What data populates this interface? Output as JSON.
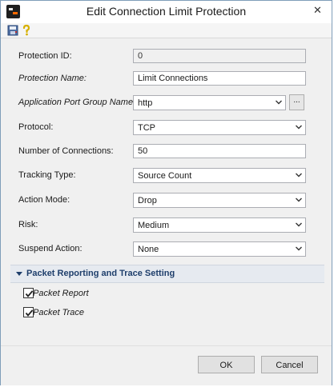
{
  "window": {
    "title": "Edit Connection Limit Protection",
    "close_glyph": "✕"
  },
  "toolbar": {
    "icons": [
      "save-icon",
      "help-icon"
    ]
  },
  "form": {
    "protection_id": {
      "label": "Protection ID:",
      "value": "0"
    },
    "protection_name": {
      "label": "Protection Name:",
      "value": "Limit Connections"
    },
    "app_port_group": {
      "label": "Application Port Group Name:",
      "value": "http",
      "browse_label": "..."
    },
    "protocol": {
      "label": "Protocol:",
      "value": "TCP"
    },
    "num_connections": {
      "label": "Number of Connections:",
      "value": "50"
    },
    "tracking_type": {
      "label": "Tracking Type:",
      "value": "Source Count"
    },
    "action_mode": {
      "label": "Action Mode:",
      "value": "Drop"
    },
    "risk": {
      "label": "Risk:",
      "value": "Medium"
    },
    "suspend_action": {
      "label": "Suspend Action:",
      "value": "None"
    }
  },
  "packet_section": {
    "title": "Packet Reporting and Trace Setting",
    "packet_report": {
      "label": "Packet Report",
      "checked": true
    },
    "packet_trace": {
      "label": "Packet Trace",
      "checked": true
    }
  },
  "buttons": {
    "ok": "OK",
    "cancel": "Cancel"
  }
}
